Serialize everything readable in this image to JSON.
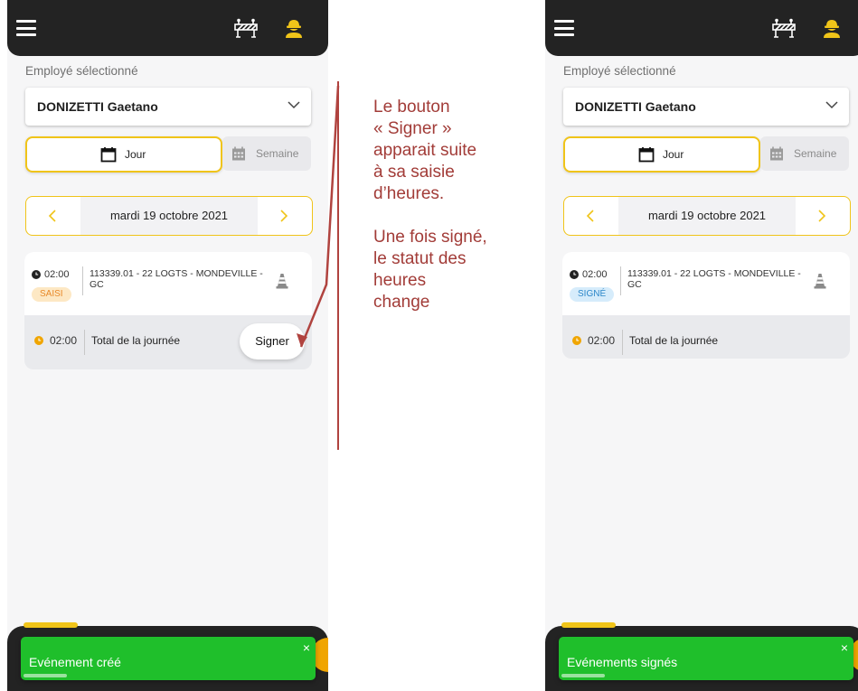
{
  "colors": {
    "accent_yellow": "#f0c419",
    "dark_bar": "#232323",
    "toast_green": "#1fbf2b",
    "annotation_red": "#a23c38",
    "badge_saisi_bg": "#fde8c4",
    "badge_saisi_text": "#e88a2a",
    "badge_signe_bg": "#d6ecfb",
    "badge_signe_text": "#2c87c9"
  },
  "icons": {
    "menu": "hamburger-icon",
    "barrier": "road-barrier-icon",
    "worker": "construction-worker-icon",
    "dropdown": "chevron-down-icon",
    "day": "calendar-icon",
    "week": "calendar-grid-icon",
    "previous": "chevron-left-icon",
    "next": "chevron-right-icon",
    "entry_clock": "clock-icon",
    "total_clock": "clock-icon",
    "cone": "traffic-cone-icon"
  },
  "screens": [
    {
      "employee_label": "Employé sélectionné",
      "employee_value": "DONIZETTI Gaetano",
      "tab_day": "Jour",
      "tab_week": "Semaine",
      "date": "mardi 19 octobre 2021",
      "entry": {
        "time": "02:00",
        "project": "113339.01 - 22 LOGTS - MONDEVILLE - GC",
        "status": "SAISI"
      },
      "total": {
        "time": "02:00",
        "label": "Total de la journée"
      },
      "sign_button": "Signer",
      "toast": "Evénement créé",
      "toast_close": "×"
    },
    {
      "employee_label": "Employé sélectionné",
      "employee_value": "DONIZETTI Gaetano",
      "tab_day": "Jour",
      "tab_week": "Semaine",
      "date": "mardi 19 octobre 2021",
      "entry": {
        "time": "02:00",
        "project": "113339.01 - 22 LOGTS - MONDEVILLE - GC",
        "status": "SIGNÉ"
      },
      "total": {
        "time": "02:00",
        "label": "Total de la journée"
      },
      "toast": "Evénements signés",
      "toast_close": "×"
    }
  ],
  "annotation": {
    "line1": "Le bouton",
    "line2": "« Signer »",
    "line3": "apparait suite",
    "line4": "à sa saisie",
    "line5": "d’heures.",
    "line6": "Une fois signé,",
    "line7": "le statut des",
    "line8": "heures",
    "line9": "change"
  }
}
